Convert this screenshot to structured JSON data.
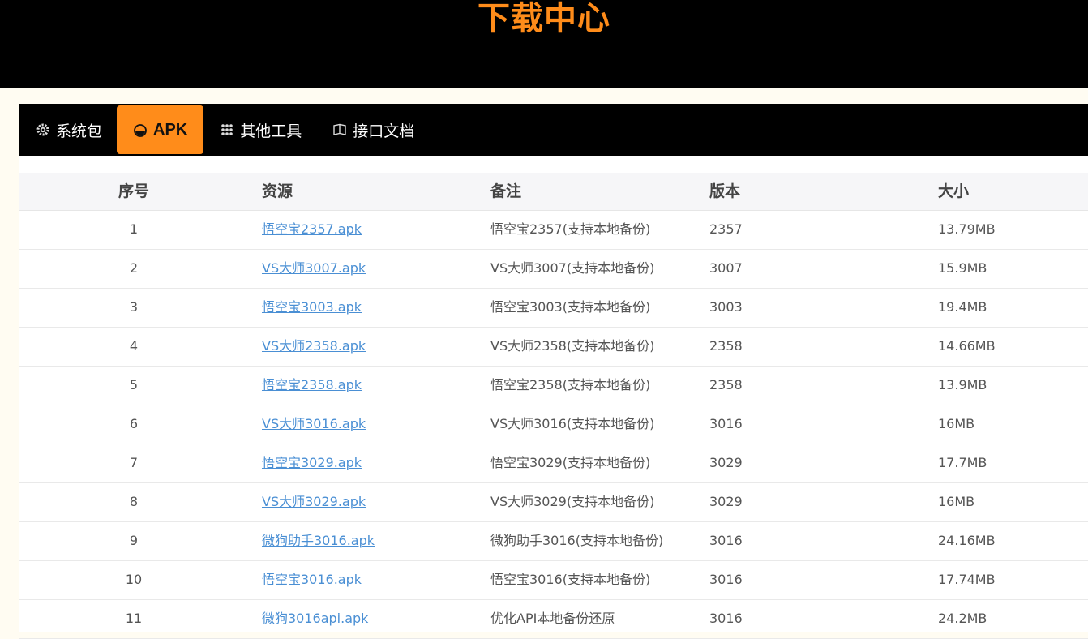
{
  "header": {
    "title": "下载中心"
  },
  "tabs": [
    {
      "label": "系统包",
      "icon": "gear-icon",
      "active": false
    },
    {
      "label": "APK",
      "icon": "android-icon",
      "active": true
    },
    {
      "label": "其他工具",
      "icon": "grid-icon",
      "active": false
    },
    {
      "label": "接口文档",
      "icon": "book-icon",
      "active": false
    }
  ],
  "table": {
    "columns": [
      "序号",
      "资源",
      "备注",
      "版本",
      "大小"
    ],
    "rows": [
      {
        "no": "1",
        "resource": "悟空宝2357.apk",
        "note": "悟空宝2357(支持本地备份)",
        "version": "2357",
        "size": "13.79MB"
      },
      {
        "no": "2",
        "resource": "VS大师3007.apk",
        "note": "VS大师3007(支持本地备份)",
        "version": "3007",
        "size": "15.9MB"
      },
      {
        "no": "3",
        "resource": "悟空宝3003.apk",
        "note": "悟空宝3003(支持本地备份)",
        "version": "3003",
        "size": "19.4MB"
      },
      {
        "no": "4",
        "resource": "VS大师2358.apk",
        "note": "VS大师2358(支持本地备份)",
        "version": "2358",
        "size": "14.66MB"
      },
      {
        "no": "5",
        "resource": "悟空宝2358.apk",
        "note": "悟空宝2358(支持本地备份)",
        "version": "2358",
        "size": "13.9MB"
      },
      {
        "no": "6",
        "resource": "VS大师3016.apk",
        "note": "VS大师3016(支持本地备份)",
        "version": "3016",
        "size": "16MB"
      },
      {
        "no": "7",
        "resource": "悟空宝3029.apk",
        "note": "悟空宝3029(支持本地备份)",
        "version": "3029",
        "size": "17.7MB"
      },
      {
        "no": "8",
        "resource": "VS大师3029.apk",
        "note": "VS大师3029(支持本地备份)",
        "version": "3029",
        "size": "16MB"
      },
      {
        "no": "9",
        "resource": "微狗助手3016.apk",
        "note": "微狗助手3016(支持本地备份)",
        "version": "3016",
        "size": "24.16MB"
      },
      {
        "no": "10",
        "resource": "悟空宝3016.apk",
        "note": "悟空宝3016(支持本地备份)",
        "version": "3016",
        "size": "17.74MB"
      },
      {
        "no": "11",
        "resource": "微狗3016api.apk",
        "note": "优化API本地备份还原",
        "version": "3016",
        "size": "24.2MB"
      }
    ]
  },
  "colors": {
    "accent": "#ff8c1a",
    "link": "#4a8fd4",
    "header_bg": "#000000"
  }
}
